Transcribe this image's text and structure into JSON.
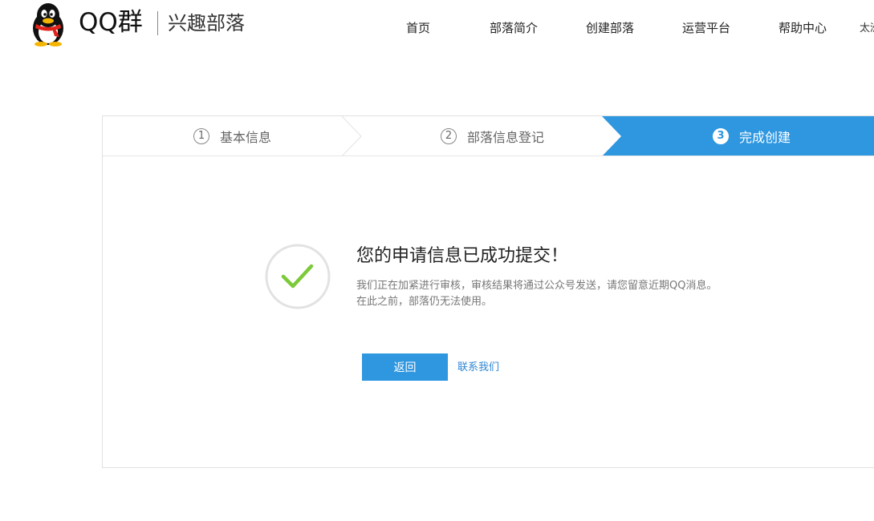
{
  "header": {
    "logo_icon": "qq-penguin-icon",
    "brand": "QQ群",
    "subtitle": "兴趣部落",
    "nav": [
      {
        "label": "首页"
      },
      {
        "label": "部落简介"
      },
      {
        "label": "创建部落"
      },
      {
        "label": "运营平台"
      },
      {
        "label": "帮助中心"
      }
    ],
    "nav_overflow": "太洲"
  },
  "steps": [
    {
      "number": "1",
      "label": "基本信息",
      "state": "done"
    },
    {
      "number": "2",
      "label": "部落信息登记",
      "state": "done"
    },
    {
      "number": "3",
      "label": "完成创建",
      "state": "active"
    }
  ],
  "result": {
    "icon": "checkmark-icon",
    "title": "您的申请信息已成功提交！",
    "description_1": "我们正在加紧进行审核，审核结果将通过公众号发送，请您留意近期QQ消息。",
    "description_2": "在此之前，部落仍无法使用。",
    "back_button": "返回",
    "contact_link": "联系我们"
  },
  "colors": {
    "accent": "#2e97e0",
    "check": "#7cc93a",
    "link": "#2f87d4"
  }
}
